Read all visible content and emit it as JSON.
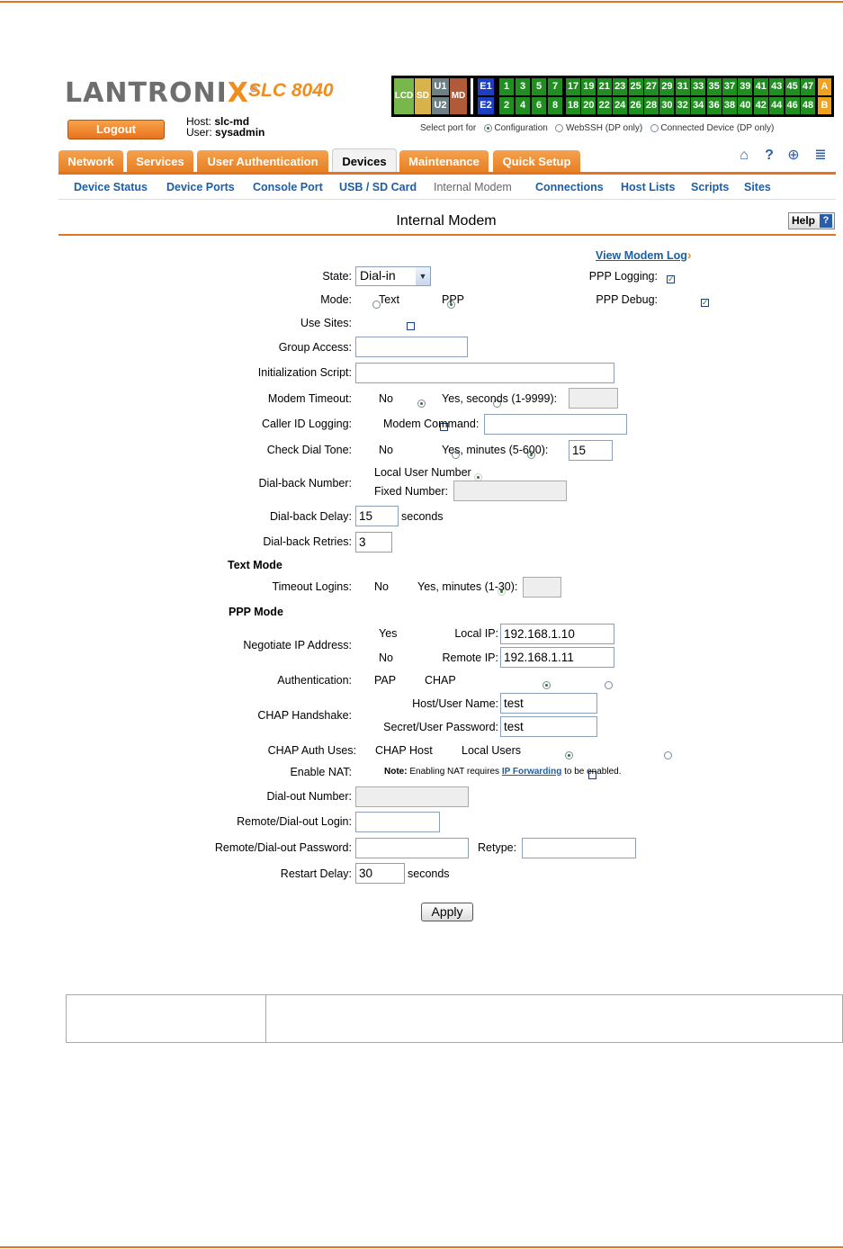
{
  "header": {
    "logo_main": "LANTRONI",
    "logo_x": "X",
    "logo_reg": "®",
    "model": "SLC 8040",
    "logout": "Logout",
    "host_label": "Host:",
    "host_value": "slc-md",
    "user_label": "User:",
    "user_value": "sysadmin"
  },
  "port_panel": {
    "lcd": "LCD",
    "sd": "SD",
    "u1": "U1",
    "u2": "U2",
    "md": "MD",
    "e1": "E1",
    "e2": "E2",
    "top_ports": [
      "1",
      "3",
      "5",
      "7",
      "17",
      "19",
      "21",
      "23",
      "25",
      "27",
      "29",
      "31",
      "33",
      "35",
      "37",
      "39",
      "41",
      "43",
      "45",
      "47"
    ],
    "bottom_ports": [
      "2",
      "4",
      "6",
      "8",
      "18",
      "20",
      "22",
      "24",
      "26",
      "28",
      "30",
      "32",
      "34",
      "36",
      "38",
      "40",
      "42",
      "44",
      "46",
      "48"
    ],
    "a": "A",
    "b": "B",
    "select_for": "Select port for",
    "opt_config": "Configuration",
    "opt_webssh": "WebSSH (DP only)",
    "opt_connected": "Connected Device (DP only)"
  },
  "tabs": [
    "Network",
    "Services",
    "User Authentication",
    "Devices",
    "Maintenance",
    "Quick Setup"
  ],
  "subnav": [
    "Device Status",
    "Device Ports",
    "Console Port",
    "USB / SD Card",
    "Internal Modem",
    "Connections",
    "Host Lists",
    "Scripts",
    "Sites"
  ],
  "icons": {
    "home": "⌂",
    "help": "?",
    "network": "⊕",
    "log": "≣"
  },
  "page": {
    "title": "Internal Modem",
    "help": "Help",
    "help_q": "?",
    "view_log": "View Modem Log",
    "view_log_arrow": "›"
  },
  "form": {
    "state_label": "State:",
    "state_value": "Dial-in",
    "ppp_logging": "PPP Logging:",
    "ppp_debug": "PPP Debug:",
    "mode_label": "Mode:",
    "mode_text": "Text",
    "mode_ppp": "PPP",
    "use_sites": "Use Sites:",
    "group_access": "Group Access:",
    "init_script": "Initialization Script:",
    "modem_timeout": "Modem Timeout:",
    "no": "No",
    "yes_seconds": "Yes, seconds (1-9999):",
    "caller_id": "Caller ID Logging:",
    "modem_command": "Modem Command:",
    "check_dial_tone": "Check Dial Tone:",
    "yes_minutes": "Yes, minutes (5-600):",
    "dial_tone_value": "15",
    "dialback_number": "Dial-back Number:",
    "local_user_number": "Local User Number",
    "fixed_number": "Fixed Number:",
    "dialback_delay": "Dial-back Delay:",
    "dialback_delay_value": "15",
    "seconds": "seconds",
    "dialback_retries": "Dial-back Retries:",
    "dialback_retries_value": "3",
    "text_mode": "Text Mode",
    "timeout_logins": "Timeout Logins:",
    "yes_minutes_30": "Yes, minutes (1-30):",
    "ppp_mode": "PPP Mode",
    "negotiate_ip": "Negotiate IP Address:",
    "yes": "Yes",
    "local_ip": "Local IP:",
    "local_ip_value": "192.168.1.10",
    "remote_ip": "Remote IP:",
    "remote_ip_value": "192.168.1.11",
    "authentication": "Authentication:",
    "pap": "PAP",
    "chap": "CHAP",
    "chap_handshake": "CHAP Handshake:",
    "host_user_name": "Host/User Name:",
    "host_user_value": "test",
    "secret_password": "Secret/User Password:",
    "secret_value": "test",
    "chap_auth_uses": "CHAP Auth Uses:",
    "chap_host": "CHAP Host",
    "local_users": "Local Users",
    "enable_nat": "Enable NAT:",
    "note_bold": "Note:",
    "note_text": " Enabling NAT requires ",
    "note_link": "IP Forwarding",
    "note_end": " to be enabled.",
    "dialout_number": "Dial-out Number:",
    "remote_login": "Remote/Dial-out Login:",
    "remote_password": "Remote/Dial-out Password:",
    "retype": "Retype:",
    "restart_delay": "Restart Delay:",
    "restart_value": "30",
    "apply": "Apply"
  },
  "colors": {
    "accent": "#e8731e",
    "link": "#1b5fa8",
    "port_green": "#1f8f1f"
  }
}
